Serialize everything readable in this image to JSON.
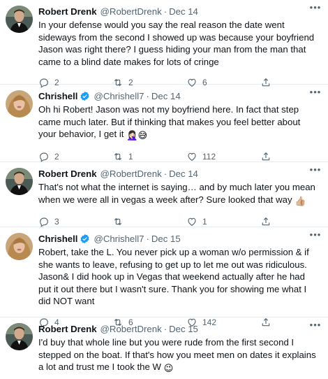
{
  "tweets": [
    {
      "name": "Robert Drenk",
      "handle": "@RobertDrenk",
      "date": "Dec 14",
      "verified": false,
      "avatar": "robert",
      "text": "In your defense would you say the real reason the date went sideways from the second I showed up was because your boyfriend Jason was right there? I guess hiding your man from the man that came to a blind date makes for lots of cringe",
      "emoji": "",
      "replies": "2",
      "retweets": "2",
      "likes": "6"
    },
    {
      "name": "Chrishell",
      "handle": "@Chrishell7",
      "date": "Dec 14",
      "verified": true,
      "avatar": "chrishell",
      "text": "Oh hi Robert! Jason was not my boyfriend here. In fact that step came much later. But if thinking that makes you feel better about your behavior, I get it",
      "emoji": "🤦🏻‍♀️😅",
      "replies": "2",
      "retweets": "1",
      "likes": "112"
    },
    {
      "name": "Robert Drenk",
      "handle": "@RobertDrenk",
      "date": "Dec 14",
      "verified": false,
      "avatar": "robert",
      "text": "That's not what the internet is saying… and by much later you mean when we were all in vegas a week after? Sure looked that way",
      "emoji": "👍🏼",
      "replies": "3",
      "retweets": "",
      "likes": "1"
    },
    {
      "name": "Chrishell",
      "handle": "@Chrishell7",
      "date": "Dec 15",
      "verified": true,
      "avatar": "chrishell",
      "text": "Robert, take the L. You never pick up a woman w/o permission & if she wants to leave, refusing to get up to let me out was ridiculous. Jason& I did hook up in Vegas that weekend actually after he had put it out there but I wasn't sure. Thank you for showing me what I did NOT want",
      "emoji": "",
      "replies": "4",
      "retweets": "6",
      "likes": "142"
    },
    {
      "name": "Robert Drenk",
      "handle": "@RobertDrenk",
      "date": "Dec 15",
      "verified": false,
      "avatar": "robert",
      "text": "I'd buy that whole line but you were rude from the first second I stepped on the boat. If that's how you meet men on dates it explains a lot and trust me I took the W",
      "emoji": "😉",
      "replies": "",
      "retweets": "",
      "likes": ""
    }
  ],
  "separator": "·",
  "more_icon": "ellipsis-icon",
  "colors": {
    "text": "#0f1419",
    "secondary": "#536471",
    "verified": "#1d9bf0",
    "divider": "#e6ecf0"
  }
}
